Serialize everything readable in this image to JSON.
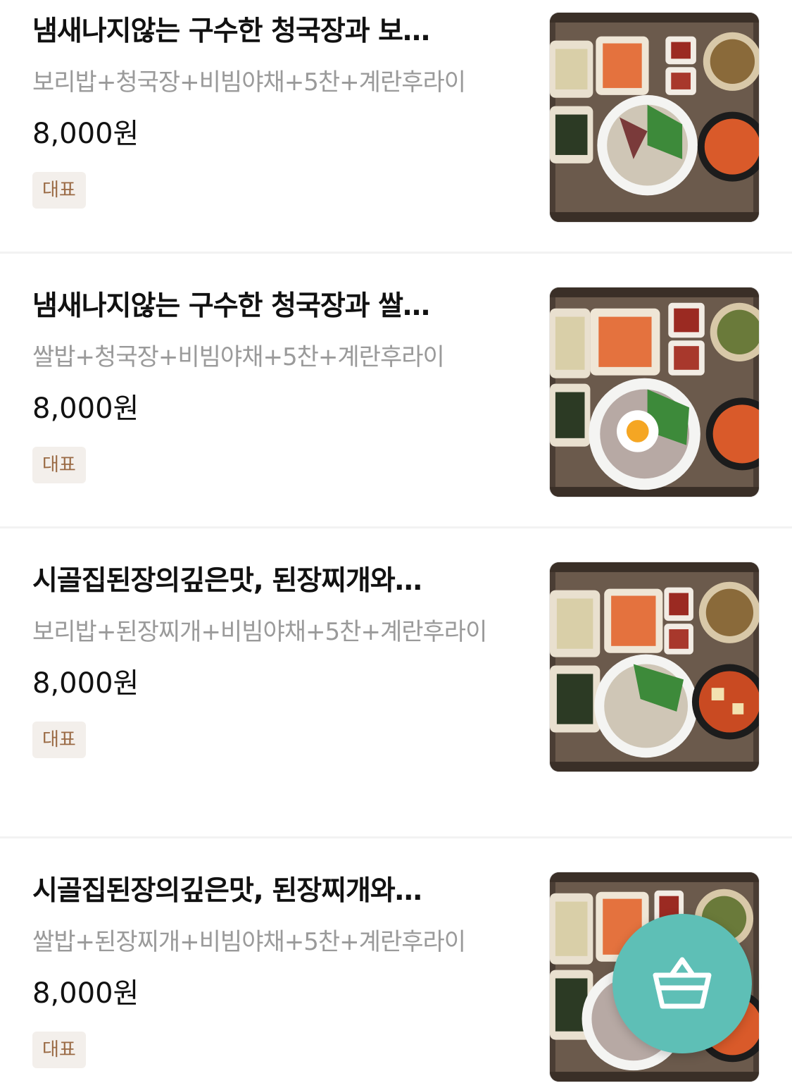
{
  "menu": {
    "items": [
      {
        "title": "냄새나지않는 구수한 청국장과 보…",
        "desc": "보리밥+청국장+비빔야채+5찬+계란후라이",
        "price": "8,000원",
        "badge": "대표",
        "image_icon": "food-photo-icon"
      },
      {
        "title": "냄새나지않는 구수한 청국장과 쌀…",
        "desc": "쌀밥+청국장+비빔야채+5찬+계란후라이",
        "price": "8,000원",
        "badge": "대표",
        "image_icon": "food-photo-icon"
      },
      {
        "title": "시골집된장의깊은맛, 된장찌개와…",
        "desc": "보리밥+된장찌개+비빔야채+5찬+계란후라이",
        "price": "8,000원",
        "badge": "대표",
        "image_icon": "food-photo-icon"
      },
      {
        "title": "시골집된장의깊은맛, 된장찌개와…",
        "desc": "쌀밥+된장찌개+비빔야채+5찬+계란후라이",
        "price": "8,000원",
        "badge": "대표",
        "image_icon": "food-photo-icon"
      }
    ]
  },
  "cart_button": {
    "icon": "basket-icon",
    "color": "#5ebfb6"
  },
  "colors": {
    "price_text": "#111111",
    "desc_text": "#9a9a9a",
    "badge_bg": "#f3efeb",
    "badge_text": "#9a6a44"
  }
}
